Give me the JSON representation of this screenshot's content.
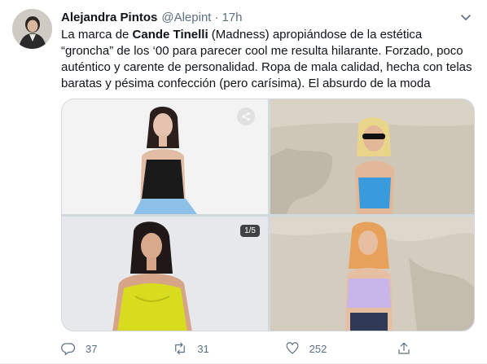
{
  "tweet": {
    "author_name": "Alejandra Pintos",
    "author_handle": "@Alepint",
    "separator": "·",
    "time": "17h",
    "text_before": "La marca de ",
    "text_bold": "Cande Tinelli",
    "text_after": " (Madness) apropiándose de la estética “groncha” de los ‘00 para parecer cool me resulta hilarante. Forzado, poco auténtico y carente de personalidad. Ropa de mala calidad, hecha con telas baratas y pésima confección (pero carísima). El absurdo de la moda"
  },
  "media": {
    "count_badge": "1/5"
  },
  "actions": {
    "reply_count": "37",
    "retweet_count": "31",
    "like_count": "252"
  },
  "colors": {
    "text": "#0f1419",
    "secondary": "#5b7083",
    "border": "#cfd9de"
  },
  "icons": [
    "caret-down-icon",
    "share-image-icon",
    "reply-icon",
    "retweet-icon",
    "like-icon",
    "share-icon"
  ]
}
